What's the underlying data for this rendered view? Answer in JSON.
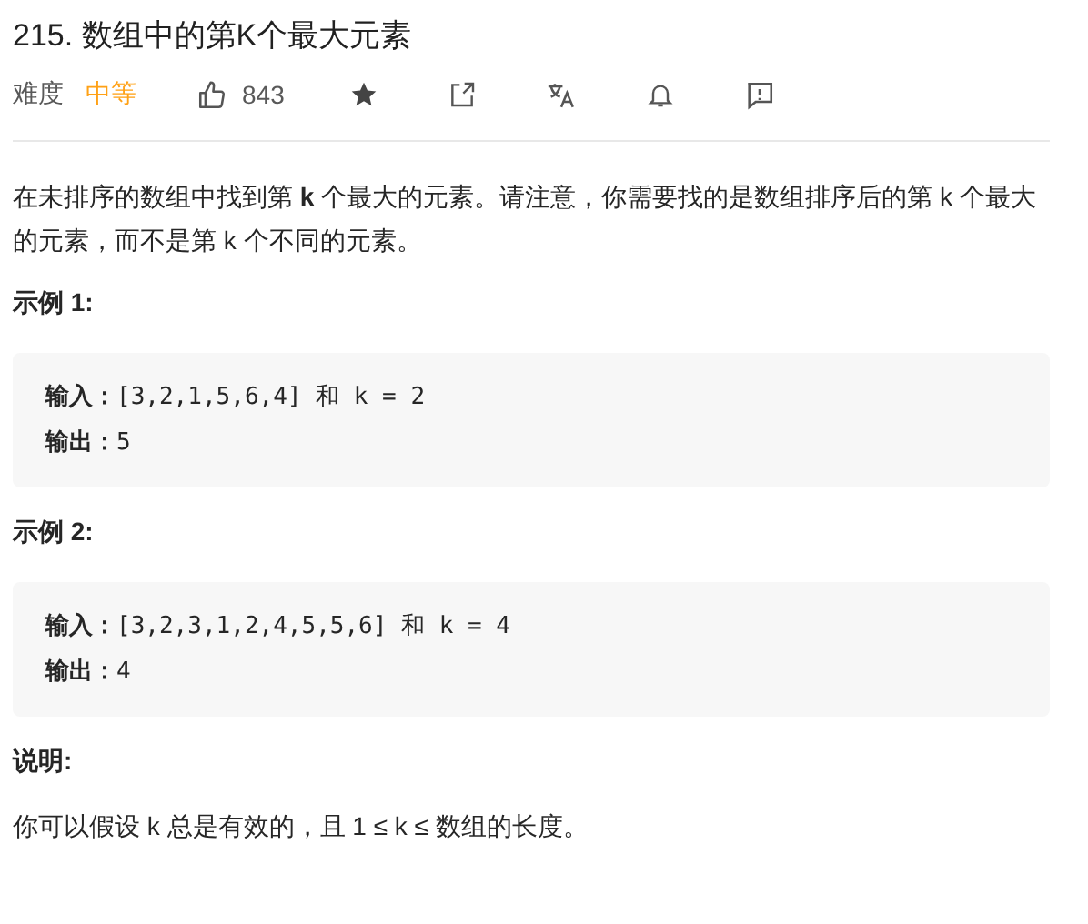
{
  "title": "215. 数组中的第K个最大元素",
  "meta": {
    "difficulty_label": "难度",
    "difficulty": "中等",
    "likes": "843"
  },
  "description": "在未排序的数组中找到第 **k** 个最大的元素。请注意，你需要找的是数组排序后的第 k 个最大的元素，而不是第 k 个不同的元素。",
  "examples": [
    {
      "heading": "示例 1:",
      "lines": [
        "**输入：**[3,2,1,5,6,4] 和 k = 2",
        "**输出：**5"
      ]
    },
    {
      "heading": "示例 2:",
      "lines": [
        "**输入：**[3,2,3,1,2,4,5,5,6] 和 k = 4",
        "**输出：**4"
      ]
    }
  ],
  "note": {
    "heading": "说明:",
    "text": "你可以假设 k 总是有效的，且 1 ≤ k ≤ 数组的长度。"
  }
}
